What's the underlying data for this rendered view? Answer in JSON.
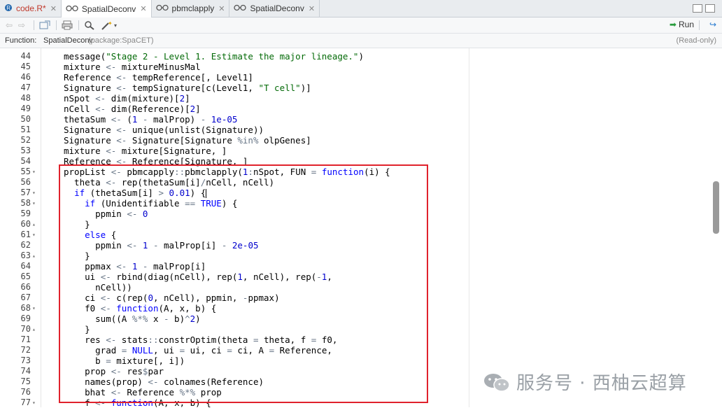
{
  "tabs": [
    {
      "label": "code.R*",
      "active": false,
      "icon": "r-script-icon"
    },
    {
      "label": "SpatialDeconv",
      "active": true,
      "icon": "viewer-icon"
    },
    {
      "label": "pbmclapply",
      "active": false,
      "icon": "viewer-icon"
    },
    {
      "label": "SpatialDeconv",
      "active": false,
      "icon": "viewer-icon"
    }
  ],
  "toolbar": {
    "run_label": "Run"
  },
  "infobar": {
    "function_label": "Function:",
    "function_name": "SpatialDeconv",
    "package": "(package:SpaCET)",
    "readonly": "(Read-only)"
  },
  "code_lines": [
    {
      "n": "44",
      "fold": "",
      "html": "message(<span class=\"str\">\"Stage 2 - Level 1. Estimate the major lineage.\"</span>)"
    },
    {
      "n": "45",
      "fold": "",
      "html": "mixture <span class=\"op\">&lt;-</span> mixtureMinusMal"
    },
    {
      "n": "46",
      "fold": "",
      "html": "Reference <span class=\"op\">&lt;-</span> tempReference[, Level1]"
    },
    {
      "n": "47",
      "fold": "",
      "html": "Signature <span class=\"op\">&lt;-</span> tempSignature[c(Level1, <span class=\"str\">\"T cell\"</span>)]"
    },
    {
      "n": "48",
      "fold": "",
      "html": "nSpot <span class=\"op\">&lt;-</span> dim(mixture)[<span class=\"num\">2</span>]"
    },
    {
      "n": "49",
      "fold": "",
      "html": "nCell <span class=\"op\">&lt;-</span> dim(Reference)[<span class=\"num\">2</span>]"
    },
    {
      "n": "50",
      "fold": "",
      "html": "thetaSum <span class=\"op\">&lt;-</span> (<span class=\"num\">1</span> <span class=\"op\">-</span> malProp) <span class=\"op\">-</span> <span class=\"num\">1e-05</span>"
    },
    {
      "n": "51",
      "fold": "",
      "html": "Signature <span class=\"op\">&lt;-</span> unique(unlist(Signature))"
    },
    {
      "n": "52",
      "fold": "",
      "html": "Signature <span class=\"op\">&lt;-</span> Signature[Signature <span class=\"op\">%in%</span> olpGenes]"
    },
    {
      "n": "53",
      "fold": "",
      "html": "mixture <span class=\"op\">&lt;-</span> mixture[Signature, ]"
    },
    {
      "n": "54",
      "fold": "",
      "html": "Reference <span class=\"op\">&lt;-</span> Reference[Signature, ]"
    },
    {
      "n": "55",
      "fold": "▾",
      "html": "propList <span class=\"op\">&lt;-</span> pbmcapply<span class=\"op\">::</span>pbmclapply(<span class=\"num\">1</span><span class=\"op\">:</span>nSpot, FUN <span class=\"op\">=</span> <span class=\"kw\">function</span>(i) {"
    },
    {
      "n": "56",
      "fold": "",
      "html": "  theta <span class=\"op\">&lt;-</span> rep(thetaSum[i]<span class=\"op\">/</span>nCell, nCell)"
    },
    {
      "n": "57",
      "fold": "▾",
      "html": "  <span class=\"kw\">if</span> (thetaSum[i] <span class=\"op\">&gt;</span> <span class=\"num\">0.01</span>) {<span class=\"cursor\"></span>"
    },
    {
      "n": "58",
      "fold": "▾",
      "html": "    <span class=\"kw\">if</span> (Unidentifiable <span class=\"op\">==</span> <span class=\"kw\">TRUE</span>) {"
    },
    {
      "n": "59",
      "fold": "",
      "html": "      ppmin <span class=\"op\">&lt;-</span> <span class=\"num\">0</span>"
    },
    {
      "n": "60",
      "fold": "▴",
      "html": "    }"
    },
    {
      "n": "61",
      "fold": "▾",
      "html": "    <span class=\"kw\">else</span> {"
    },
    {
      "n": "62",
      "fold": "",
      "html": "      ppmin <span class=\"op\">&lt;-</span> <span class=\"num\">1</span> <span class=\"op\">-</span> malProp[i] <span class=\"op\">-</span> <span class=\"num\">2e-05</span>"
    },
    {
      "n": "63",
      "fold": "▴",
      "html": "    }"
    },
    {
      "n": "64",
      "fold": "",
      "html": "    ppmax <span class=\"op\">&lt;-</span> <span class=\"num\">1</span> <span class=\"op\">-</span> malProp[i]"
    },
    {
      "n": "65",
      "fold": "",
      "html": "    ui <span class=\"op\">&lt;-</span> rbind(diag(nCell), rep(<span class=\"num\">1</span>, nCell), rep(<span class=\"op\">-</span><span class=\"num\">1</span>,"
    },
    {
      "n": "66",
      "fold": "",
      "html": "      nCell))"
    },
    {
      "n": "67",
      "fold": "",
      "html": "    ci <span class=\"op\">&lt;-</span> c(rep(<span class=\"num\">0</span>, nCell), ppmin, <span class=\"op\">-</span>ppmax)"
    },
    {
      "n": "68",
      "fold": "▾",
      "html": "    f0 <span class=\"op\">&lt;-</span> <span class=\"kw\">function</span>(A, x, b) {"
    },
    {
      "n": "69",
      "fold": "",
      "html": "      sum((A <span class=\"op\">%*%</span> x <span class=\"op\">-</span> b)<span class=\"op\">^</span><span class=\"num\">2</span>)"
    },
    {
      "n": "70",
      "fold": "▴",
      "html": "    }"
    },
    {
      "n": "71",
      "fold": "",
      "html": "    res <span class=\"op\">&lt;-</span> stats<span class=\"op\">::</span>constrOptim(theta <span class=\"op\">=</span> theta, f <span class=\"op\">=</span> f0,"
    },
    {
      "n": "72",
      "fold": "",
      "html": "      grad <span class=\"op\">=</span> <span class=\"kw\">NULL</span>, ui <span class=\"op\">=</span> ui, ci <span class=\"op\">=</span> ci, A <span class=\"op\">=</span> Reference,"
    },
    {
      "n": "73",
      "fold": "",
      "html": "      b <span class=\"op\">=</span> mixture[, i])"
    },
    {
      "n": "74",
      "fold": "",
      "html": "    prop <span class=\"op\">&lt;-</span> res<span class=\"op\">$</span>par"
    },
    {
      "n": "75",
      "fold": "",
      "html": "    names(prop) <span class=\"op\">&lt;-</span> colnames(Reference)"
    },
    {
      "n": "76",
      "fold": "",
      "html": "    bhat <span class=\"op\">&lt;-</span> Reference <span class=\"op\">%*%</span> prop"
    },
    {
      "n": "77",
      "fold": "▾",
      "html": "    f <span class=\"op\">&lt;-</span> <span class=\"kw\">function</span>(A, x, b) {"
    }
  ],
  "watermark": {
    "text": "服务号 · 西柚云超算"
  }
}
